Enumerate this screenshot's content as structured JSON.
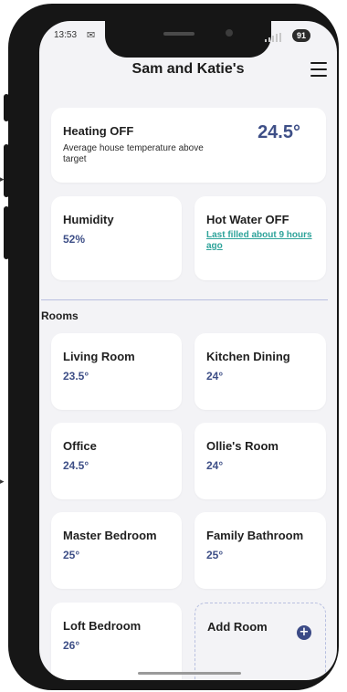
{
  "status_bar": {
    "time": "13:53",
    "battery": "91"
  },
  "header": {
    "title": "Sam and Katie's"
  },
  "heating": {
    "title": "Heating OFF",
    "subtitle": "Average house temperature above target",
    "value": "24.5°"
  },
  "humidity": {
    "title": "Humidity",
    "value": "52%"
  },
  "hot_water": {
    "title": "Hot Water OFF",
    "link": "Last filled about 9 hours ago"
  },
  "rooms_section": {
    "label": "Rooms"
  },
  "rooms": [
    {
      "name": "Living Room",
      "temp": "23.5°"
    },
    {
      "name": "Kitchen Dining",
      "temp": "24°"
    },
    {
      "name": "Office",
      "temp": "24.5°"
    },
    {
      "name": "Ollie's Room",
      "temp": "24°"
    },
    {
      "name": "Master Bedroom",
      "temp": "25°"
    },
    {
      "name": "Family Bathroom",
      "temp": "25°"
    },
    {
      "name": "Loft Bedroom",
      "temp": "26°"
    }
  ],
  "add_room": {
    "label": "Add Room"
  }
}
